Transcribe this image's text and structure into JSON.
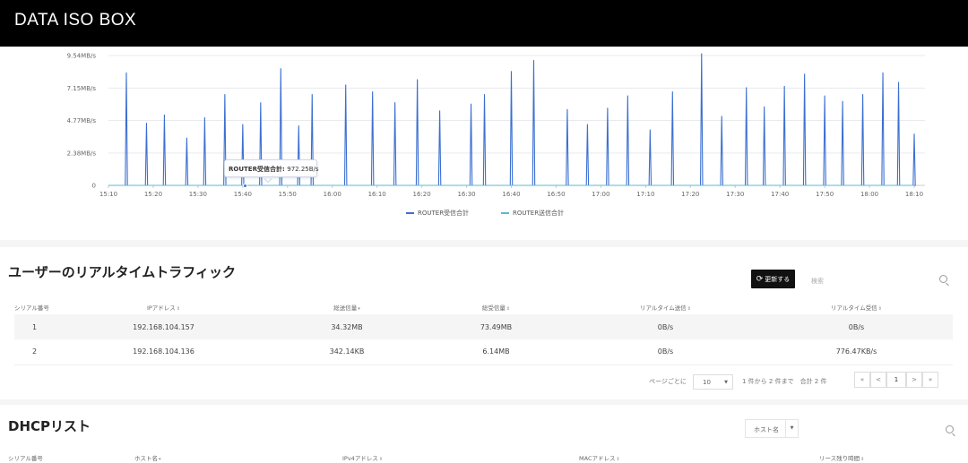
{
  "app": {
    "title": "DATA ISO BOX"
  },
  "chart_data": {
    "type": "line",
    "y_tick_labels": [
      "0",
      "2.38MB/s",
      "4.77MB/s",
      "7.15MB/s",
      "9.54MB/s"
    ],
    "y_tick_values": [
      0,
      2.38,
      4.77,
      7.15,
      9.54
    ],
    "x_tick_labels": [
      "15:10",
      "15:20",
      "15:30",
      "15:40",
      "15:50",
      "16:00",
      "16:10",
      "16:20",
      "16:30",
      "16:40",
      "16:50",
      "17:00",
      "17:10",
      "17:20",
      "17:30",
      "17:40",
      "17:50",
      "18:00",
      "18:10"
    ],
    "x_range_minutes": [
      0,
      180
    ],
    "unit": "MB/s",
    "grid": true,
    "legend_position": "bottom",
    "series": [
      {
        "name": "ROUTER受信合計",
        "color": "#3b6fd1",
        "spikes": [
          {
            "t": 4,
            "v": 8.3
          },
          {
            "t": 8.5,
            "v": 4.6
          },
          {
            "t": 12.5,
            "v": 5.2
          },
          {
            "t": 17.5,
            "v": 3.5
          },
          {
            "t": 21.5,
            "v": 5.0
          },
          {
            "t": 26,
            "v": 6.7
          },
          {
            "t": 30,
            "v": 4.5
          },
          {
            "t": 34,
            "v": 6.1
          },
          {
            "t": 38.5,
            "v": 8.6
          },
          {
            "t": 42.5,
            "v": 4.4
          },
          {
            "t": 45.5,
            "v": 6.7
          },
          {
            "t": 53,
            "v": 7.4
          },
          {
            "t": 59,
            "v": 6.9
          },
          {
            "t": 64,
            "v": 6.1
          },
          {
            "t": 69,
            "v": 7.8
          },
          {
            "t": 74,
            "v": 5.5
          },
          {
            "t": 81,
            "v": 6.0
          },
          {
            "t": 84,
            "v": 6.7
          },
          {
            "t": 90,
            "v": 8.4
          },
          {
            "t": 95,
            "v": 9.2
          },
          {
            "t": 102.5,
            "v": 5.6
          },
          {
            "t": 107,
            "v": 4.5
          },
          {
            "t": 111.5,
            "v": 5.7
          },
          {
            "t": 116,
            "v": 6.6
          },
          {
            "t": 121,
            "v": 4.1
          },
          {
            "t": 126,
            "v": 6.9
          },
          {
            "t": 132.5,
            "v": 9.7
          },
          {
            "t": 137,
            "v": 5.1
          },
          {
            "t": 142.5,
            "v": 7.2
          },
          {
            "t": 146.5,
            "v": 5.8
          },
          {
            "t": 151,
            "v": 7.3
          },
          {
            "t": 155.5,
            "v": 8.2
          },
          {
            "t": 160,
            "v": 6.6
          },
          {
            "t": 164,
            "v": 6.2
          },
          {
            "t": 168.5,
            "v": 6.7
          },
          {
            "t": 173,
            "v": 8.3
          },
          {
            "t": 176.5,
            "v": 7.6
          },
          {
            "t": 180,
            "v": 3.8
          }
        ]
      },
      {
        "name": "ROUTER送信合計",
        "color": "#5ab8d8",
        "spikes": []
      }
    ],
    "tooltip": {
      "label": "ROUTER受信合計",
      "value": "972.25B/s"
    }
  },
  "users": {
    "title": "ユーザーのリアルタイムトラフィック",
    "refresh_label": "更新する",
    "search_placeholder": "検索",
    "columns": [
      "シリアル番号",
      "IPアドレス",
      "総送信量",
      "総受信量",
      "リアルタイム送信",
      "リアルタイム受信"
    ],
    "sort_marks": [
      "",
      "⇕",
      "▾",
      "⇕",
      "⇕",
      "⇕"
    ],
    "rows": [
      [
        "1",
        "192.168.104.157",
        "34.32MB",
        "73.49MB",
        "0B/s",
        "0B/s"
      ],
      [
        "2",
        "192.168.104.136",
        "342.14KB",
        "6.14MB",
        "0B/s",
        "776.47KB/s"
      ]
    ],
    "pagination": {
      "per_page_label": "ページごとに",
      "per_page": "10",
      "summary": "1 件から 2 件まで　合計 2 件",
      "first": "«",
      "prev": "<",
      "page": "1",
      "next": ">",
      "last": "»"
    }
  },
  "dhcp": {
    "title": "DHCPリスト",
    "filter_value": "ホスト名",
    "columns": [
      "シリアル番号",
      "ホスト名",
      "IPv4アドレス",
      "MACアドレス",
      "リース残り時間"
    ],
    "sort_marks": [
      "",
      "▾",
      "⇕",
      "⇕",
      "⇕"
    ]
  }
}
